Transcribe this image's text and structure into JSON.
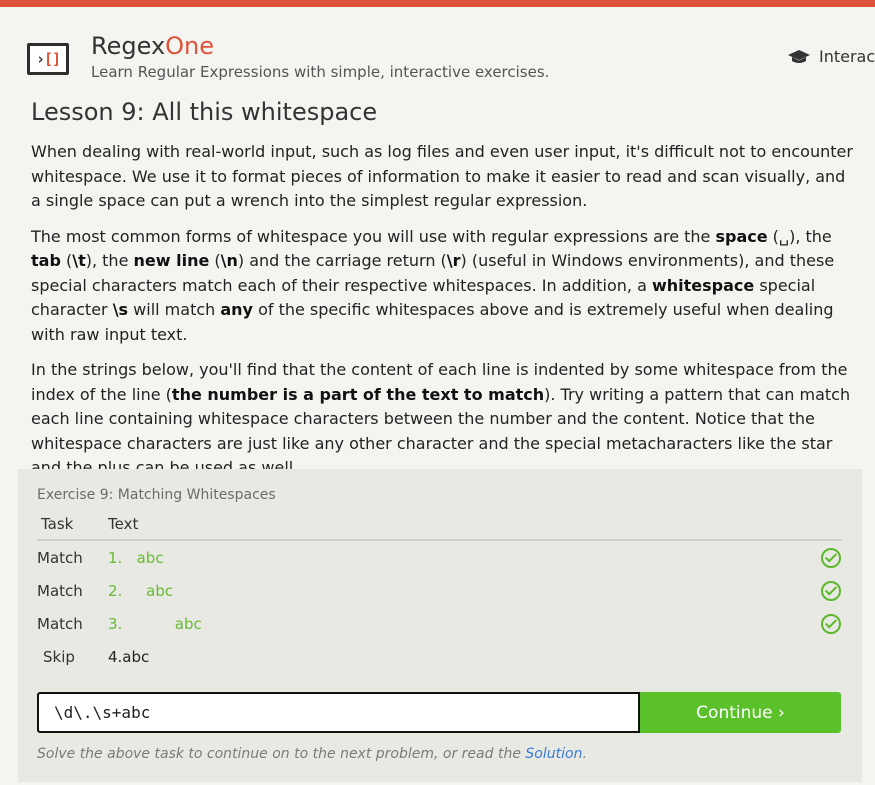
{
  "header": {
    "logo_left": "›",
    "logo_right": "[]",
    "brand_part1": "Regex",
    "brand_part2": "One",
    "tagline": "Learn Regular Expressions with simple, interactive exercises.",
    "nav_link": "Interac",
    "nav_icon": "graduation-cap-icon"
  },
  "lesson": {
    "title": "Lesson 9: All this whitespace",
    "p1": "When dealing with real-world input, such as log files and even user input, it's difficult not to encounter whitespace. We use it to format pieces of information to make it easier to read and scan visually, and a single space can put a wrench into the simplest regular expression.",
    "p2": {
      "t1": "The most common forms of whitespace you will use with regular expressions are the ",
      "b1": "space",
      "t2": " (␣), the ",
      "b2": "tab",
      "t3": " (",
      "b3": "\\t",
      "t4": "), the ",
      "b4": "new line",
      "t5": " (",
      "b5": "\\n",
      "t6": ") and the carriage return (",
      "b6": "\\r",
      "t7": ") (useful in Windows environments), and these special characters match each of their respective whitespaces. In addition, a ",
      "b7": "whitespace",
      "t8": " special character ",
      "b8": "\\s",
      "t9": " will match ",
      "b9": "any",
      "t10": " of the specific whitespaces above and is extremely useful when dealing with raw input text."
    },
    "p3": {
      "t1": "In the strings below, you'll find that the content of each line is indented by some whitespace from the index of the line (",
      "b1": "the number is a part of the text to match",
      "t2": "). Try writing a pattern that can match each line containing whitespace characters between the number and the content. Notice that the whitespace characters are just like any other character and the special metacharacters like the star and the plus can be used as well."
    }
  },
  "exercise": {
    "title": "Exercise 9: Matching Whitespaces",
    "col_task": "Task",
    "col_text": "Text",
    "rows": [
      {
        "task": "Match",
        "text": "1.   abc"
      },
      {
        "task": "Match",
        "text": "2.     abc"
      },
      {
        "task": "Match",
        "text": "3.           abc"
      },
      {
        "task": "Skip",
        "text": "4.abc"
      }
    ],
    "input_value": "\\d\\.\\s+abc",
    "continue_label": "Continue ›",
    "hint_text": "Solve the above task to continue on to the next problem, or read the ",
    "hint_link": "Solution",
    "hint_end": ".",
    "colors": {
      "match": "#66bb33",
      "accent": "#e0533a",
      "button": "#5ac12a"
    }
  }
}
